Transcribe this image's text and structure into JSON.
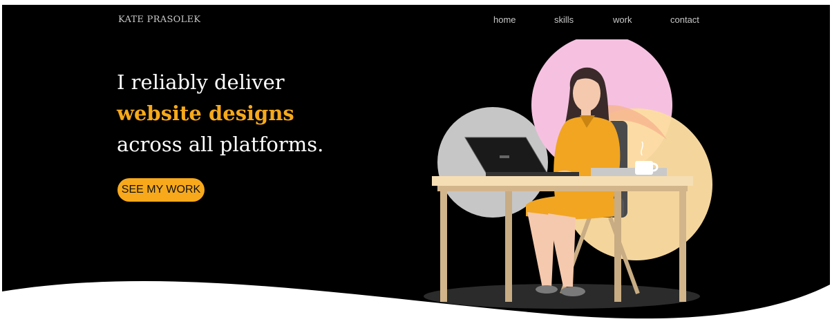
{
  "header": {
    "logo": "KATE PRASOLEK",
    "nav": [
      "home",
      "skills",
      "work",
      "contact"
    ]
  },
  "hero": {
    "line1": "I reliably deliver",
    "highlight": "website designs",
    "line3": "across all platforms.",
    "cta_label": "SEE MY WORK"
  },
  "colors": {
    "background": "#000000",
    "accent": "#f7a91b",
    "nav_text": "#c9c9c9",
    "headline_text": "#ffffff"
  },
  "icons": {
    "illustration": "woman-working-at-laptop-illustration"
  }
}
